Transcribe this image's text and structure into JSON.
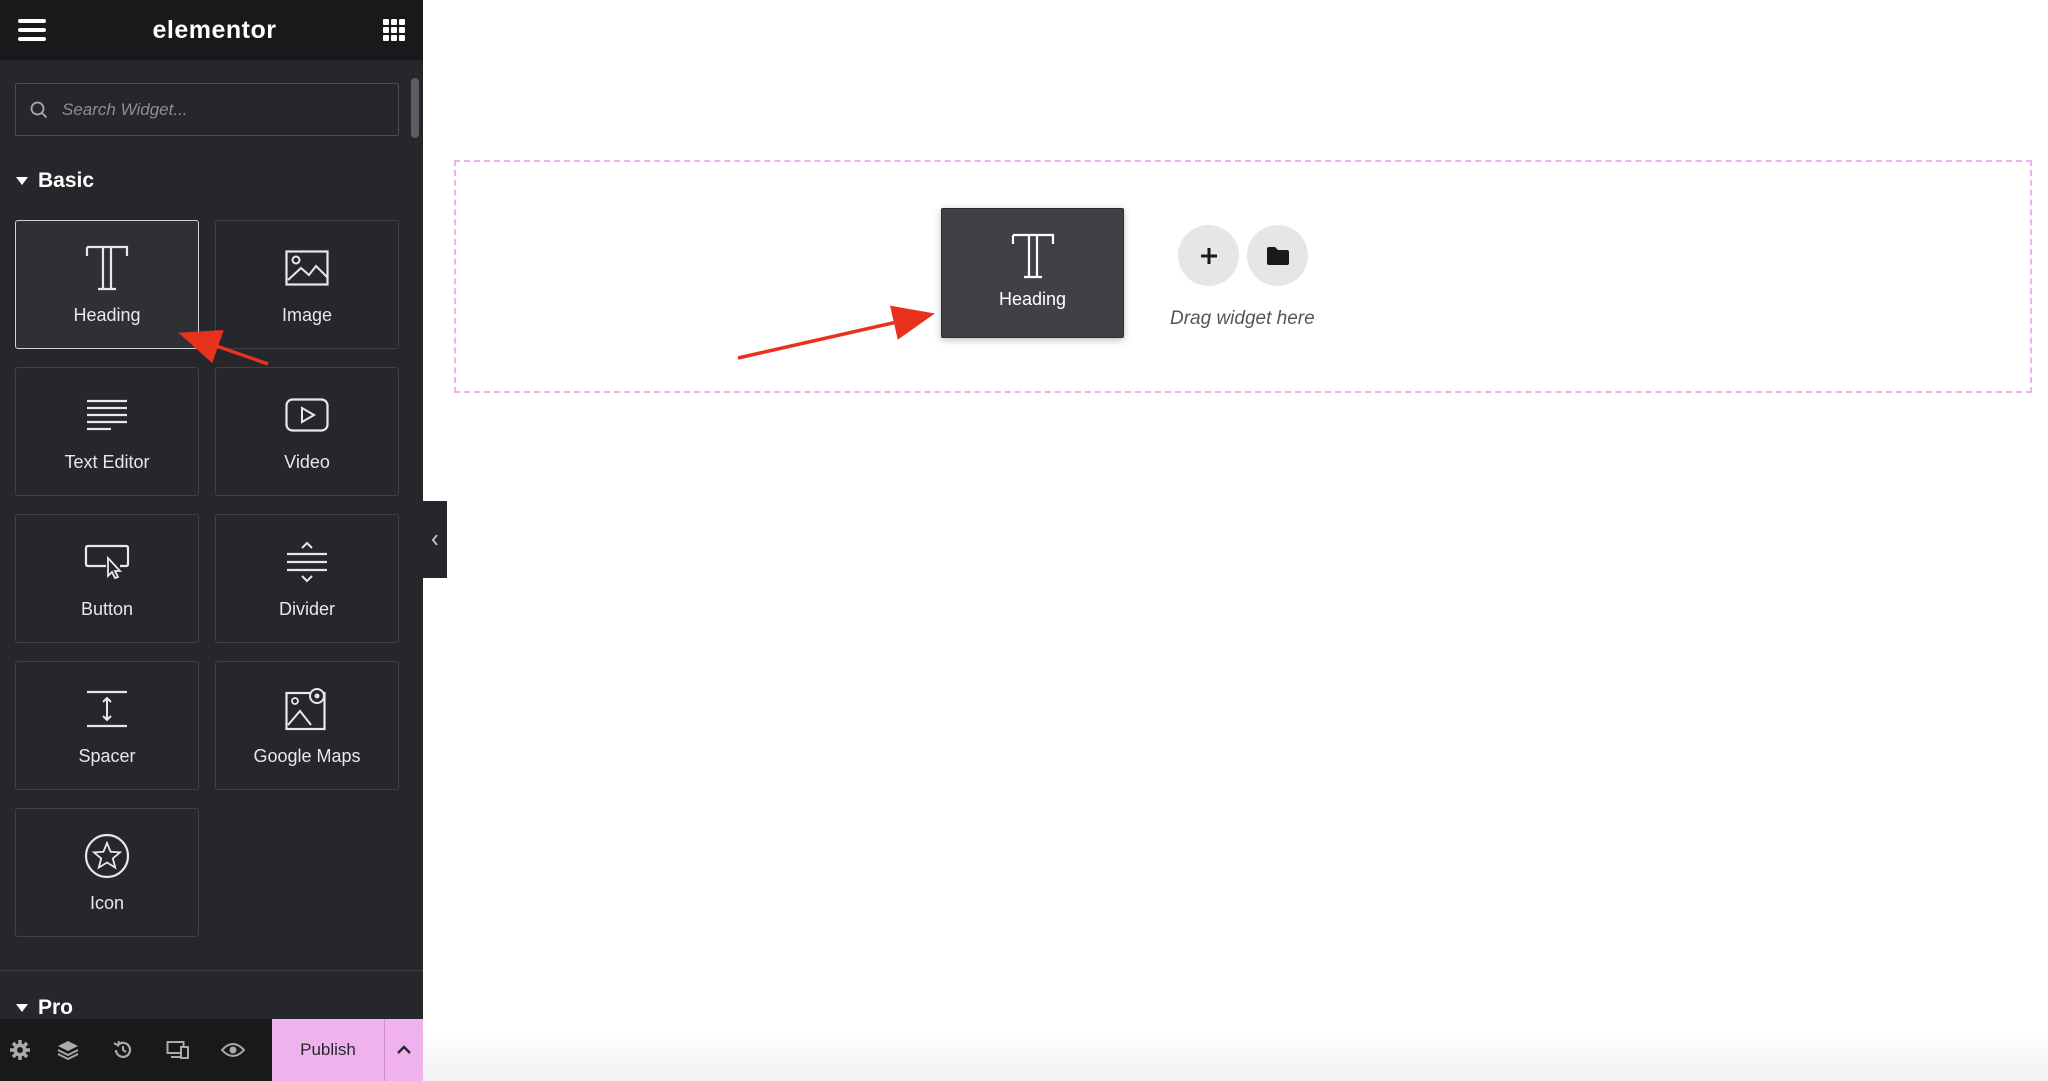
{
  "header": {
    "logo": "elementor"
  },
  "search": {
    "placeholder": "Search Widget..."
  },
  "categories": {
    "basic": "Basic",
    "pro": "Pro"
  },
  "widgets": [
    {
      "label": "Heading",
      "icon": "heading-icon"
    },
    {
      "label": "Image",
      "icon": "image-icon"
    },
    {
      "label": "Text Editor",
      "icon": "text-editor-icon"
    },
    {
      "label": "Video",
      "icon": "video-icon"
    },
    {
      "label": "Button",
      "icon": "button-icon"
    },
    {
      "label": "Divider",
      "icon": "divider-icon"
    },
    {
      "label": "Spacer",
      "icon": "spacer-icon"
    },
    {
      "label": "Google Maps",
      "icon": "google-maps-icon"
    },
    {
      "label": "Icon",
      "icon": "star-icon"
    }
  ],
  "footer": {
    "publish": "Publish"
  },
  "canvas": {
    "drag_ghost_label": "Heading",
    "drag_hint": "Drag widget here"
  },
  "colors": {
    "panel": "#26272b",
    "header": "#18191b",
    "accent": "#f0b2ec",
    "arrow": "#e8321e"
  }
}
